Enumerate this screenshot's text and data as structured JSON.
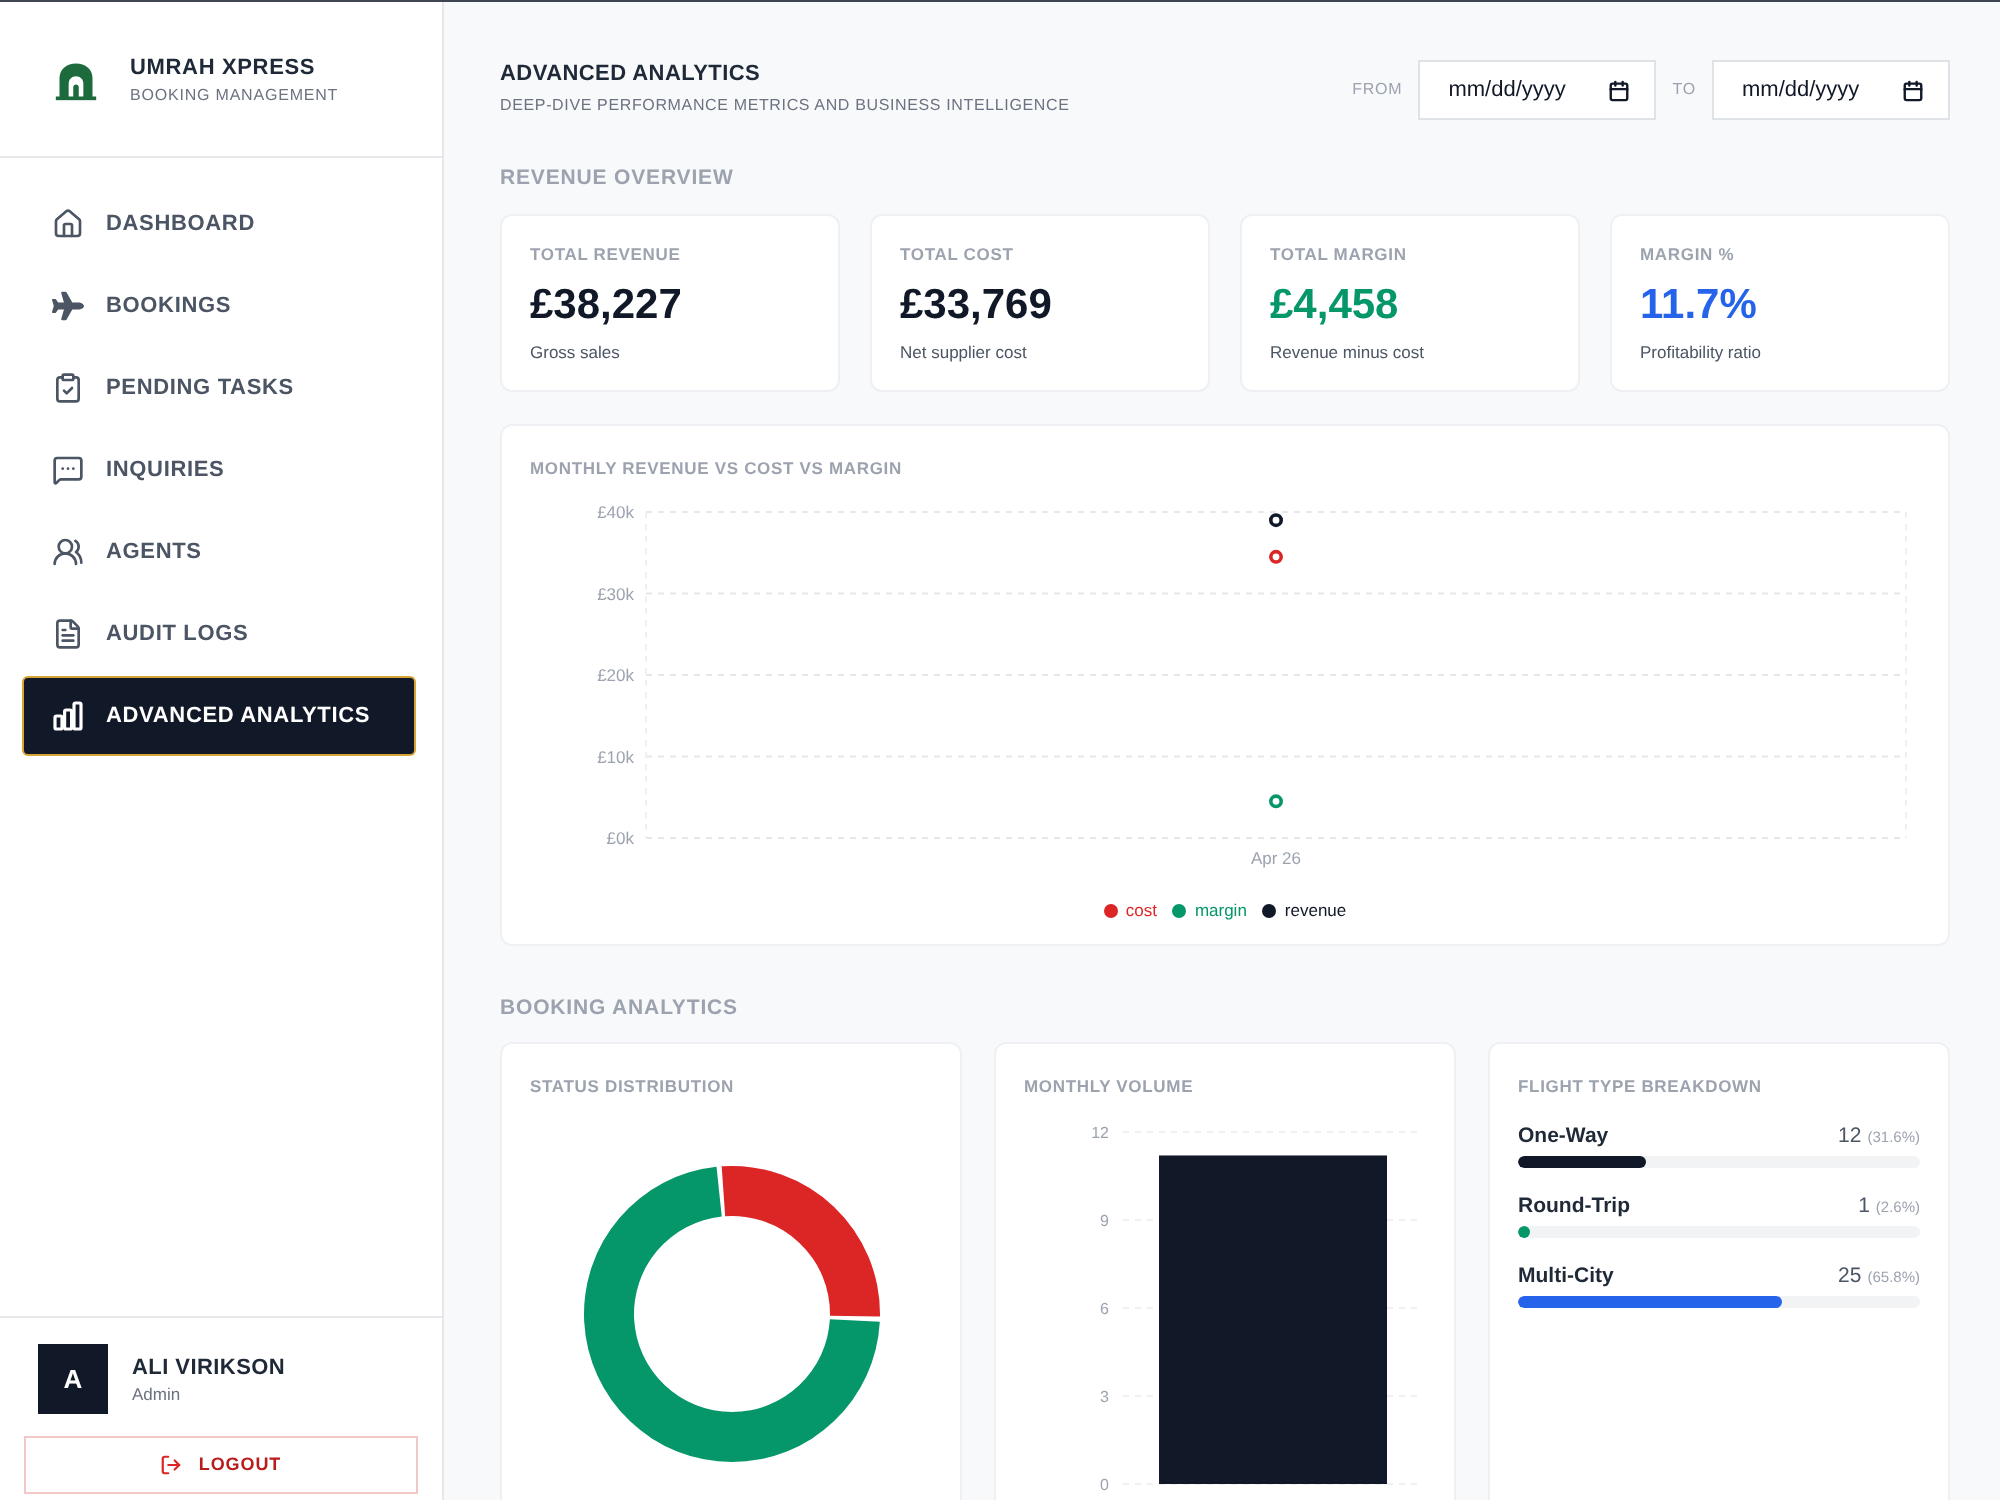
{
  "sidebar": {
    "brand": {
      "name": "UMRAH XPRESS",
      "tagline": "BOOKING MANAGEMENT"
    },
    "nav": [
      {
        "label": "DASHBOARD",
        "selected": false
      },
      {
        "label": "BOOKINGS",
        "selected": false
      },
      {
        "label": "PENDING TASKS",
        "selected": false
      },
      {
        "label": "INQUIRIES",
        "selected": false
      },
      {
        "label": "AGENTS",
        "selected": false
      },
      {
        "label": "AUDIT LOGS",
        "selected": false
      },
      {
        "label": "ADVANCED ANALYTICS",
        "selected": true
      }
    ],
    "user": {
      "initial": "A",
      "name": "ALI VIRIKSON",
      "role": "Admin"
    },
    "logout": {
      "label": "LOGOUT"
    }
  },
  "header": {
    "title": "ADVANCED ANALYTICS",
    "subtitle": "DEEP-DIVE PERFORMANCE METRICS AND BUSINESS INTELLIGENCE",
    "date_range": [
      {
        "label": "FROM",
        "placeholder": "mm/dd/yyyy"
      },
      {
        "label": "TO",
        "placeholder": "mm/dd/yyyy"
      }
    ]
  },
  "revenue_overview": {
    "heading": "REVENUE OVERVIEW",
    "kpis": [
      {
        "label": "TOTAL REVENUE",
        "value": "£38,227",
        "note": "Gross sales",
        "color": "#111827"
      },
      {
        "label": "TOTAL COST",
        "value": "£33,769",
        "note": "Net supplier cost",
        "color": "#111827"
      },
      {
        "label": "TOTAL MARGIN",
        "value": "£4,458",
        "note": "Revenue minus cost",
        "color": "#059669"
      },
      {
        "label": "MARGIN %",
        "value": "11.7%",
        "note": "Profitability ratio",
        "color": "#2563eb"
      }
    ]
  },
  "revenue_chart": {
    "title": "MONTHLY REVENUE VS COST VS MARGIN",
    "chart_data": {
      "type": "scatter",
      "categories": [
        "Apr 26"
      ],
      "series": [
        {
          "name": "cost",
          "color": "#dc2626",
          "values": [
            34500
          ]
        },
        {
          "name": "margin",
          "color": "#059669",
          "values": [
            4500
          ]
        },
        {
          "name": "revenue",
          "color": "#111827",
          "values": [
            39000
          ]
        }
      ],
      "ylim": [
        0,
        40000
      ],
      "yticks": [
        {
          "value": 0,
          "label": "£0k"
        },
        {
          "value": 10000,
          "label": "£10k"
        },
        {
          "value": 20000,
          "label": "£20k"
        },
        {
          "value": 30000,
          "label": "£30k"
        },
        {
          "value": 40000,
          "label": "£40k"
        }
      ],
      "grid": true
    }
  },
  "booking_analytics": {
    "heading": "BOOKING ANALYTICS",
    "status_distribution": {
      "title": "STATUS DISTRIBUTION"
    },
    "monthly_volume": {
      "title": "MONTHLY VOLUME",
      "chart_data": {
        "type": "bar",
        "values": [
          11.2
        ],
        "ylim": [
          0,
          12
        ],
        "yticks": [
          0,
          3,
          6,
          9,
          12
        ],
        "grid": true
      }
    },
    "flight_types": {
      "title": "FLIGHT TYPE BREAKDOWN",
      "items": [
        {
          "label": "One-Way",
          "count": "12",
          "share": "(31.6%)",
          "level": 0.316,
          "color": "#111827"
        },
        {
          "label": "Round-Trip",
          "count": "1",
          "share": "(2.6%)",
          "level": 0.026,
          "color": "#059669"
        },
        {
          "label": "Multi-City",
          "count": "25",
          "share": "(65.8%)",
          "level": 0.658,
          "color": "#2563eb"
        }
      ]
    }
  }
}
